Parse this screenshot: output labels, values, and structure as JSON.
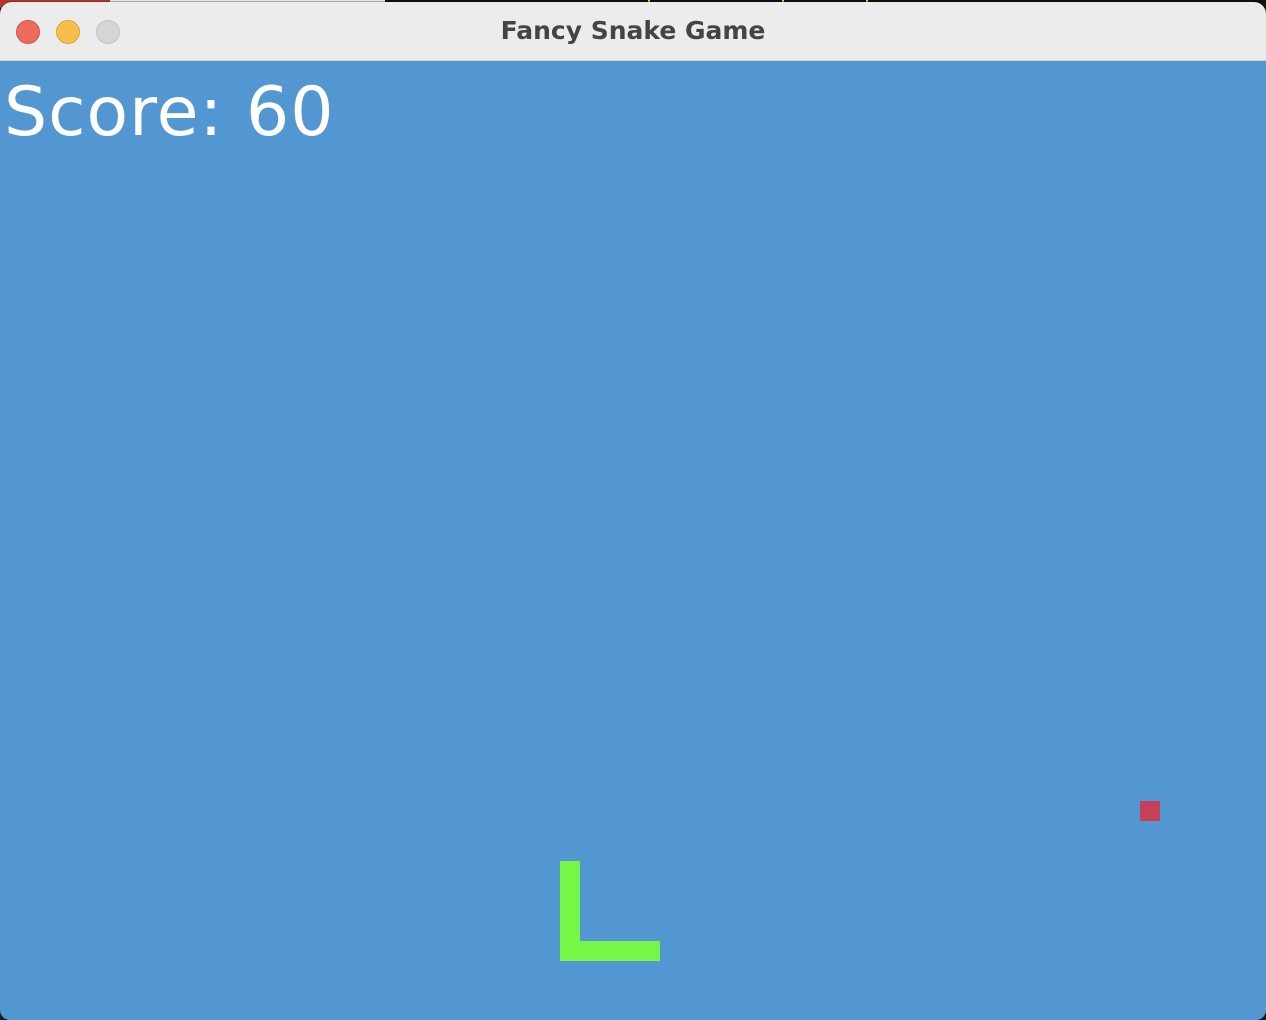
{
  "window": {
    "title": "Fancy Snake Game",
    "controls": {
      "close": "close-icon",
      "minimize": "minimize-icon",
      "zoom": "zoom-icon"
    }
  },
  "game": {
    "score_text": "Score: 60",
    "score": 60,
    "colors": {
      "background": "#5297d2",
      "snake": "#76f748",
      "food": "#c74059",
      "score_text": "#ffffff"
    }
  }
}
